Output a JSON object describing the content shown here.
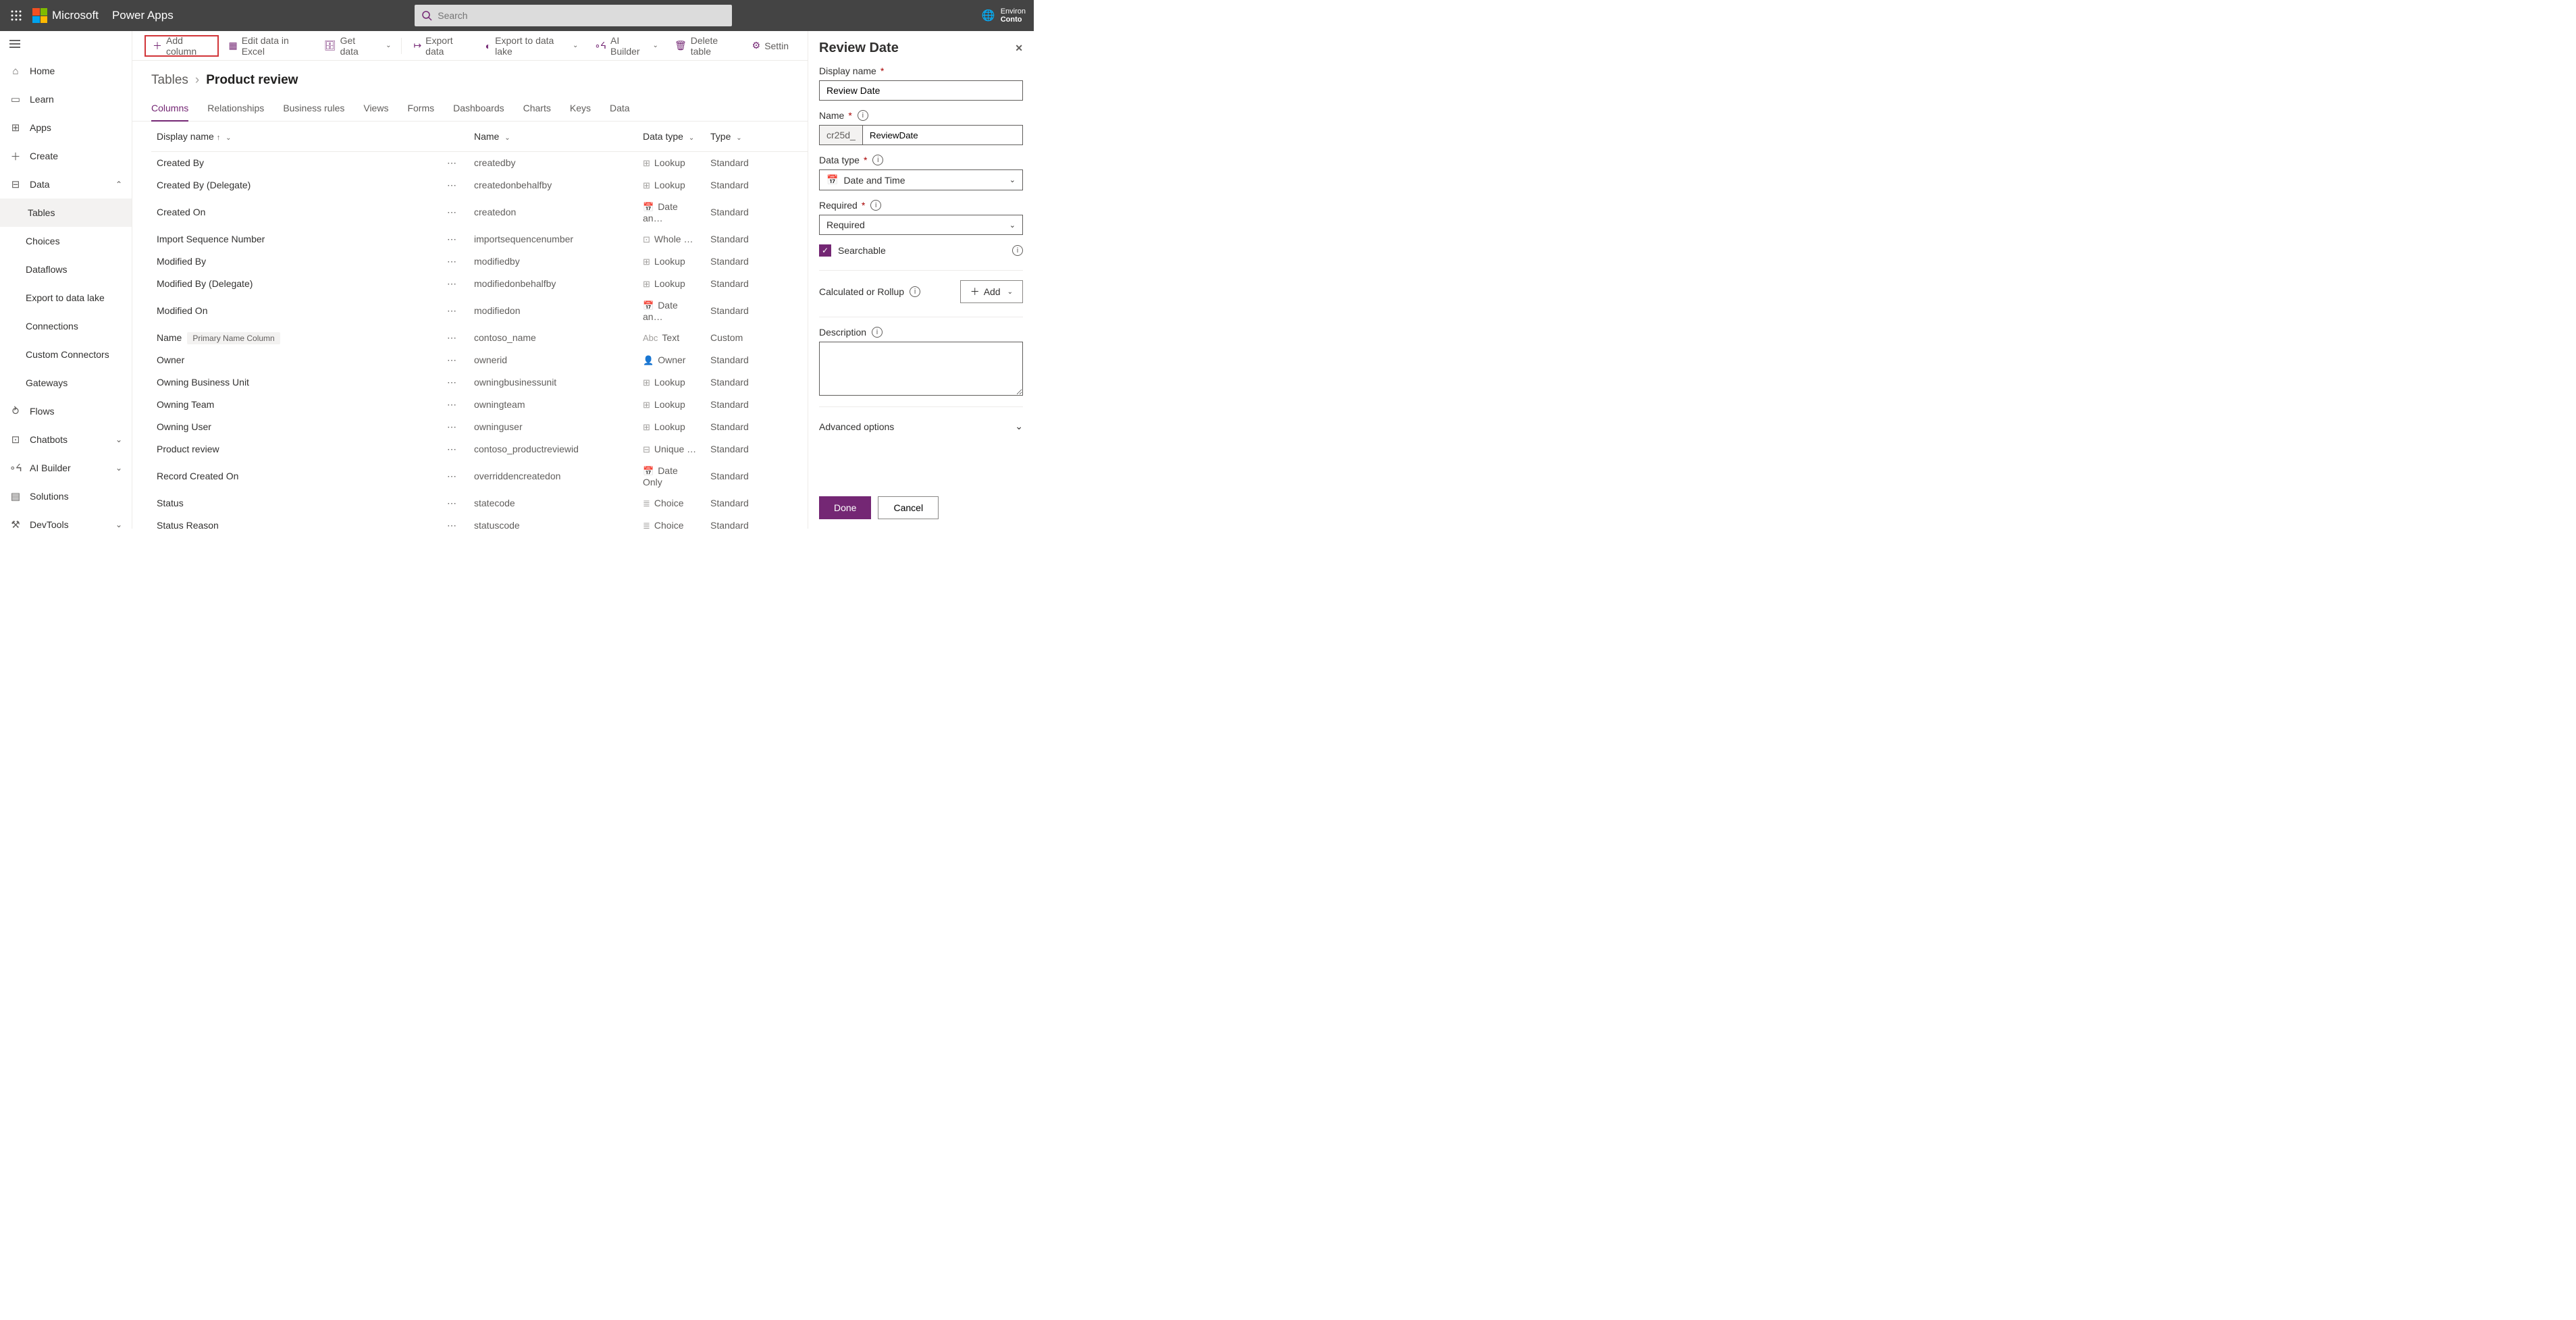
{
  "header": {
    "brand": "Microsoft",
    "app": "Power Apps",
    "search_placeholder": "Search",
    "env_label": "Environ",
    "env_name": "Conto"
  },
  "sidebar": {
    "items": [
      {
        "icon": "home",
        "label": "Home"
      },
      {
        "icon": "book",
        "label": "Learn"
      },
      {
        "icon": "grid",
        "label": "Apps"
      },
      {
        "icon": "plus",
        "label": "Create"
      },
      {
        "icon": "db",
        "label": "Data",
        "expand": true
      }
    ],
    "data_children": [
      {
        "label": "Tables",
        "selected": true
      },
      {
        "label": "Choices"
      },
      {
        "label": "Dataflows"
      },
      {
        "label": "Export to data lake"
      },
      {
        "label": "Connections"
      },
      {
        "label": "Custom Connectors"
      },
      {
        "label": "Gateways"
      }
    ],
    "items2": [
      {
        "icon": "flow",
        "label": "Flows"
      },
      {
        "icon": "chat",
        "label": "Chatbots",
        "expand": true
      },
      {
        "icon": "ai",
        "label": "AI Builder",
        "expand": true
      },
      {
        "icon": "sol",
        "label": "Solutions"
      },
      {
        "icon": "dev",
        "label": "DevTools",
        "expand": true
      }
    ]
  },
  "commands": {
    "add_column": "Add column",
    "edit_excel": "Edit data in Excel",
    "get_data": "Get data",
    "export_data": "Export data",
    "export_lake": "Export to data lake",
    "ai_builder": "AI Builder",
    "delete_table": "Delete table",
    "settings": "Settin"
  },
  "breadcrumb": {
    "root": "Tables",
    "current": "Product review"
  },
  "tabs": [
    "Columns",
    "Relationships",
    "Business rules",
    "Views",
    "Forms",
    "Dashboards",
    "Charts",
    "Keys",
    "Data"
  ],
  "active_tab": "Columns",
  "table": {
    "headers": {
      "display": "Display name",
      "name": "Name",
      "datatype": "Data type",
      "type": "Type"
    },
    "rows": [
      {
        "display": "Created By",
        "name": "createdby",
        "dt": "Lookup",
        "type": "Standard",
        "dticon": "lk"
      },
      {
        "display": "Created By (Delegate)",
        "name": "createdonbehalfby",
        "dt": "Lookup",
        "type": "Standard",
        "dticon": "lk"
      },
      {
        "display": "Created On",
        "name": "createdon",
        "dt": "Date an…",
        "type": "Standard",
        "dticon": "dt"
      },
      {
        "display": "Import Sequence Number",
        "name": "importsequencenumber",
        "dt": "Whole …",
        "type": "Standard",
        "dticon": "num"
      },
      {
        "display": "Modified By",
        "name": "modifiedby",
        "dt": "Lookup",
        "type": "Standard",
        "dticon": "lk"
      },
      {
        "display": "Modified By (Delegate)",
        "name": "modifiedonbehalfby",
        "dt": "Lookup",
        "type": "Standard",
        "dticon": "lk"
      },
      {
        "display": "Modified On",
        "name": "modifiedon",
        "dt": "Date an…",
        "type": "Standard",
        "dticon": "dt"
      },
      {
        "display": "Name",
        "name": "contoso_name",
        "dt": "Text",
        "type": "Custom",
        "dticon": "txt",
        "badge": "Primary Name Column"
      },
      {
        "display": "Owner",
        "name": "ownerid",
        "dt": "Owner",
        "type": "Standard",
        "dticon": "own"
      },
      {
        "display": "Owning Business Unit",
        "name": "owningbusinessunit",
        "dt": "Lookup",
        "type": "Standard",
        "dticon": "lk"
      },
      {
        "display": "Owning Team",
        "name": "owningteam",
        "dt": "Lookup",
        "type": "Standard",
        "dticon": "lk"
      },
      {
        "display": "Owning User",
        "name": "owninguser",
        "dt": "Lookup",
        "type": "Standard",
        "dticon": "lk"
      },
      {
        "display": "Product review",
        "name": "contoso_productreviewid",
        "dt": "Unique …",
        "type": "Standard",
        "dticon": "uid"
      },
      {
        "display": "Record Created On",
        "name": "overriddencreatedon",
        "dt": "Date Only",
        "type": "Standard",
        "dticon": "dt"
      },
      {
        "display": "Status",
        "name": "statecode",
        "dt": "Choice",
        "type": "Standard",
        "dticon": "ch"
      },
      {
        "display": "Status Reason",
        "name": "statuscode",
        "dt": "Choice",
        "type": "Standard",
        "dticon": "ch"
      }
    ]
  },
  "panel": {
    "title": "Review Date",
    "display_name_label": "Display name",
    "display_name_value": "Review Date",
    "name_label": "Name",
    "name_prefix": "cr25d_",
    "name_value": "ReviewDate",
    "data_type_label": "Data type",
    "data_type_value": "Date and Time",
    "required_label": "Required",
    "required_value": "Required",
    "searchable_label": "Searchable",
    "calc_label": "Calculated or Rollup",
    "add_label": "Add",
    "description_label": "Description",
    "advanced_label": "Advanced options",
    "done": "Done",
    "cancel": "Cancel"
  }
}
